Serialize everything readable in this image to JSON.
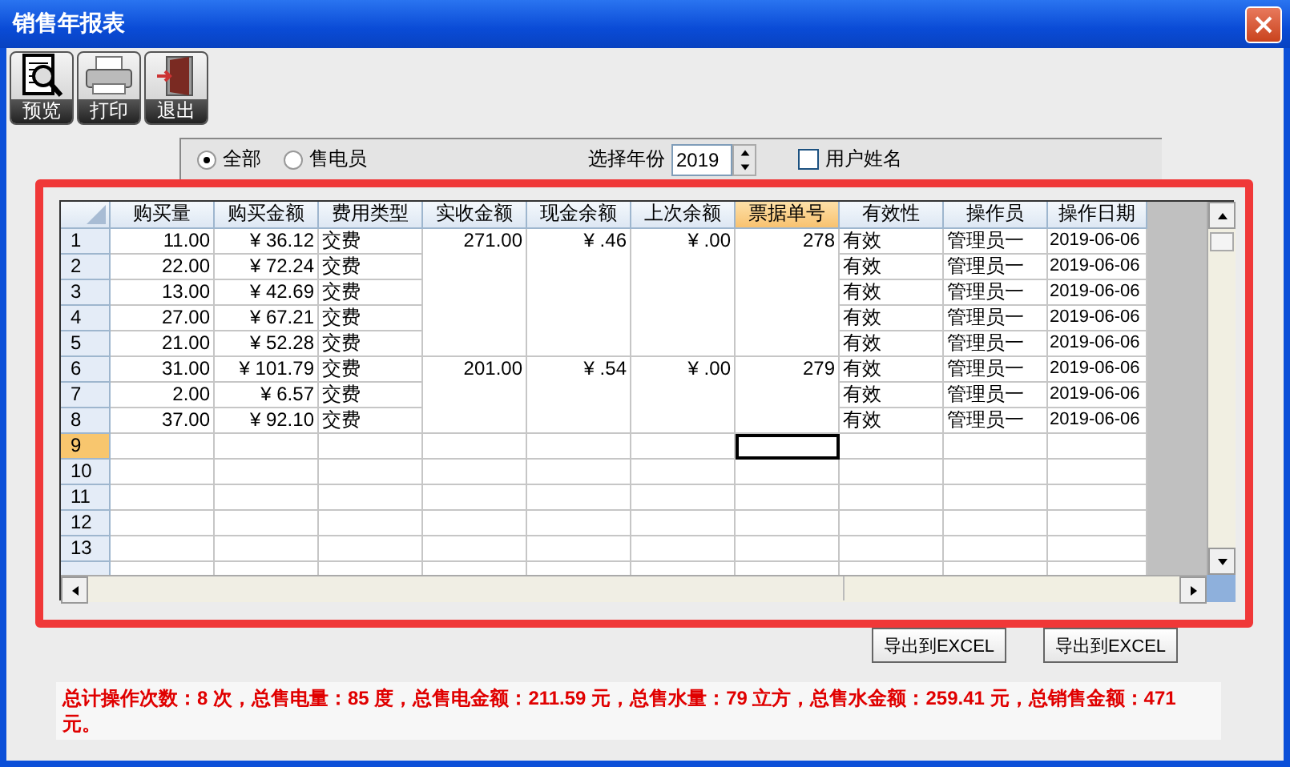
{
  "window": {
    "title": "销售年报表"
  },
  "toolbar": [
    {
      "label": "预览",
      "kind": "preview"
    },
    {
      "label": "打印",
      "kind": "print"
    },
    {
      "label": "退出",
      "kind": "exit"
    }
  ],
  "filter": {
    "scope": [
      {
        "label": "全部",
        "selected": true
      },
      {
        "label": "售电员",
        "selected": false
      }
    ],
    "year_label": "选择年份",
    "year": "2019",
    "username": {
      "label": "用户姓名",
      "checked": false
    }
  },
  "table": {
    "columns": [
      {
        "label": "购买量",
        "selected": false
      },
      {
        "label": "购买金额",
        "selected": false
      },
      {
        "label": "费用类型",
        "selected": false
      },
      {
        "label": "实收金额",
        "selected": false
      },
      {
        "label": "现金余额",
        "selected": false
      },
      {
        "label": "上次余额",
        "selected": false
      },
      {
        "label": "票据单号",
        "selected": true
      },
      {
        "label": "有效性",
        "selected": false
      },
      {
        "label": "操作员",
        "selected": false
      },
      {
        "label": "操作日期",
        "selected": false
      }
    ],
    "groups": [
      {
        "received": "271.00",
        "cash_balance": "¥ .46",
        "last_balance": "¥ .00",
        "receipt_no": "278",
        "rows": [
          {
            "label": "1",
            "qty": "11.00",
            "amount": "¥ 36.12",
            "fee_type": "交费",
            "validity": "有效",
            "operator": "管理员一",
            "date": "2019-06-06"
          },
          {
            "label": "2",
            "qty": "22.00",
            "amount": "¥ 72.24",
            "fee_type": "交费",
            "validity": "有效",
            "operator": "管理员一",
            "date": "2019-06-06"
          },
          {
            "label": "3",
            "qty": "13.00",
            "amount": "¥ 42.69",
            "fee_type": "交费",
            "validity": "有效",
            "operator": "管理员一",
            "date": "2019-06-06"
          },
          {
            "label": "4",
            "qty": "27.00",
            "amount": "¥ 67.21",
            "fee_type": "交费",
            "validity": "有效",
            "operator": "管理员一",
            "date": "2019-06-06"
          },
          {
            "label": "5",
            "qty": "21.00",
            "amount": "¥ 52.28",
            "fee_type": "交费",
            "validity": "有效",
            "operator": "管理员一",
            "date": "2019-06-06"
          }
        ]
      },
      {
        "received": "201.00",
        "cash_balance": "¥ .54",
        "last_balance": "¥ .00",
        "receipt_no": "279",
        "rows": [
          {
            "label": "6",
            "qty": "31.00",
            "amount": "¥ 101.79",
            "fee_type": "交费",
            "validity": "有效",
            "operator": "管理员一",
            "date": "2019-06-06"
          },
          {
            "label": "7",
            "qty": "2.00",
            "amount": "¥ 6.57",
            "fee_type": "交费",
            "validity": "有效",
            "operator": "管理员一",
            "date": "2019-06-06"
          },
          {
            "label": "8",
            "qty": "37.00",
            "amount": "¥ 92.10",
            "fee_type": "交费",
            "validity": "有效",
            "operator": "管理员一",
            "date": "2019-06-06"
          }
        ]
      }
    ],
    "empty_rows": [
      {
        "label": "9",
        "selected": true
      },
      {
        "label": "10",
        "selected": false
      },
      {
        "label": "11",
        "selected": false
      },
      {
        "label": "12",
        "selected": false
      },
      {
        "label": "13",
        "selected": false
      }
    ]
  },
  "export_buttons": [
    "导出到EXCEL",
    "导出到EXCEL"
  ],
  "summary": "总计操作次数：8 次，总售电量：85 度，总售电金额：211.59 元，总售水量：79 立方，总售水金额：259.41 元，总销售金额：471 元。"
}
